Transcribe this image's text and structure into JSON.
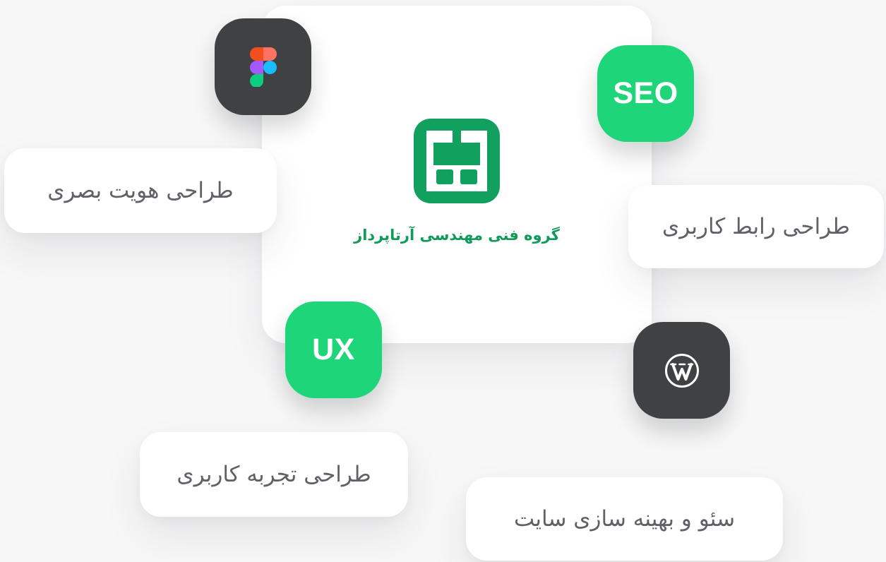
{
  "brand": {
    "name": "گروه فنی مهندسی آرتاپرداز",
    "logo_icon": "artapardaz-logo-icon",
    "accent_color": "#1ed57a",
    "brand_color": "#129a5a"
  },
  "services": {
    "visual_identity": "طراحی هویت بصری",
    "ui_design": "طراحی رابط کاربری",
    "ux_design": "طراحی تجربه کاربری",
    "seo": "سئو و بهینه سازی سایت"
  },
  "badges": {
    "figma_icon": "figma-icon",
    "seo_label": "SEO",
    "ux_label": "UX",
    "wordpress_icon": "wordpress-icon",
    "dark_color": "#3f4143"
  }
}
